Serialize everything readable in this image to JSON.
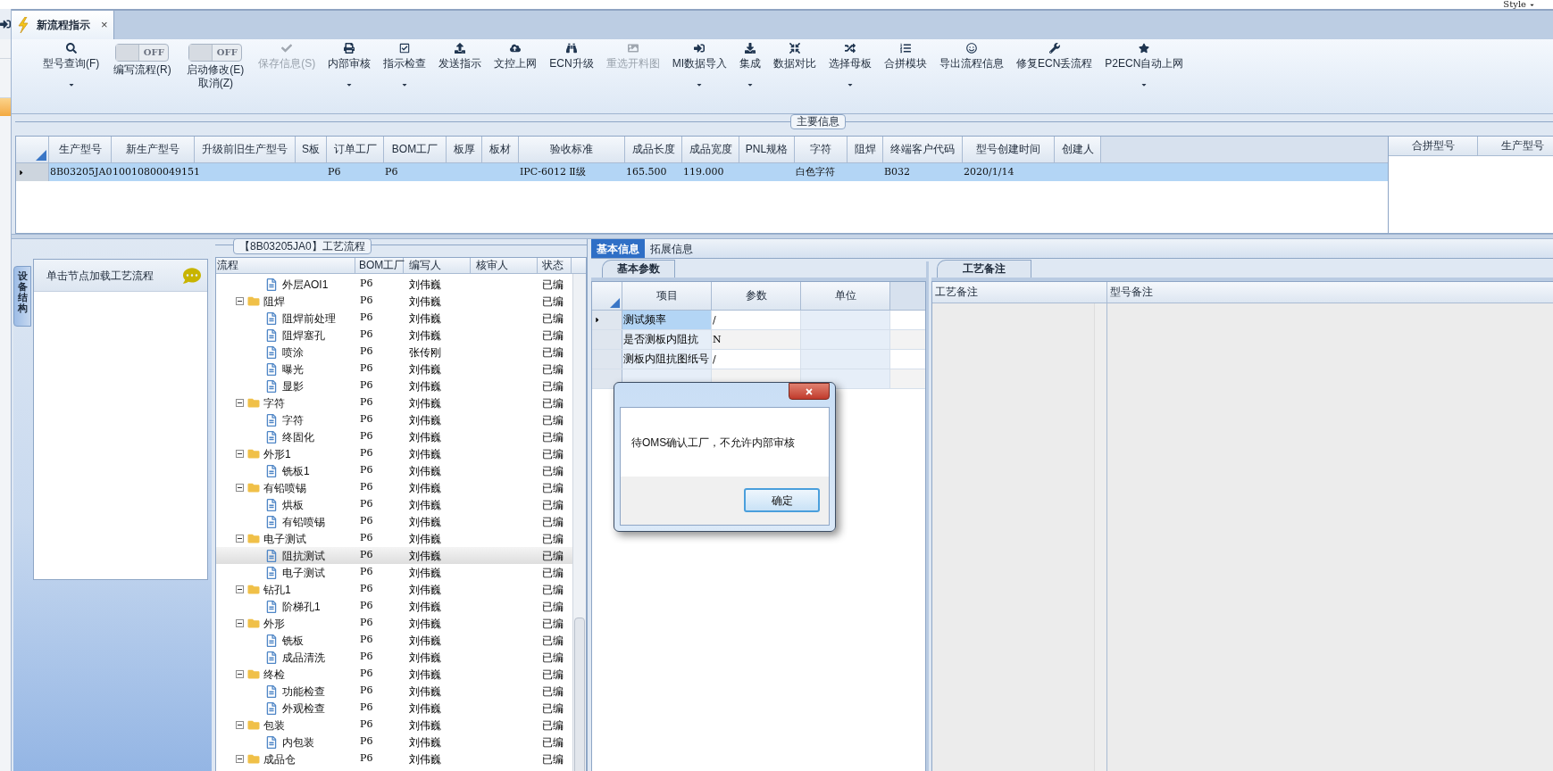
{
  "top_bar": {
    "style_menu": "Style"
  },
  "tabs": [
    {
      "label": "新流程指示",
      "selected": true,
      "close": "×"
    }
  ],
  "toolbar": [
    {
      "kind": "button",
      "label": "型号查询(F)",
      "disabled": false,
      "dropdown": true
    },
    {
      "kind": "toggle",
      "label": "编写流程(R)",
      "state_text": "OFF",
      "on": false
    },
    {
      "kind": "toggle",
      "label": "启动修改(E)\n取消(Z)",
      "state_text": "OFF",
      "on": false
    },
    {
      "kind": "button",
      "label": "保存信息(S)",
      "disabled": true,
      "dropdown": false
    },
    {
      "kind": "button",
      "label": "内部审核",
      "disabled": false,
      "dropdown": true
    },
    {
      "kind": "button",
      "label": "指示检查",
      "disabled": false,
      "dropdown": true
    },
    {
      "kind": "button",
      "label": "发送指示",
      "disabled": false,
      "dropdown": false
    },
    {
      "kind": "button",
      "label": "文控上网",
      "disabled": false,
      "dropdown": false
    },
    {
      "kind": "button",
      "label": "ECN升级",
      "disabled": false,
      "dropdown": false
    },
    {
      "kind": "button",
      "label": "重选开料图",
      "disabled": true,
      "dropdown": false
    },
    {
      "kind": "button",
      "label": "MI数据导入",
      "disabled": false,
      "dropdown": true
    },
    {
      "kind": "button",
      "label": "集成",
      "disabled": false,
      "dropdown": true
    },
    {
      "kind": "button",
      "label": "数据对比",
      "disabled": false,
      "dropdown": false
    },
    {
      "kind": "button",
      "label": "选择母板",
      "disabled": false,
      "dropdown": true
    },
    {
      "kind": "button",
      "label": "合拼模块",
      "disabled": false,
      "dropdown": false
    },
    {
      "kind": "button",
      "label": "导出流程信息",
      "disabled": false,
      "dropdown": false
    },
    {
      "kind": "button",
      "label": "修复ECN丢流程",
      "disabled": false,
      "dropdown": false
    },
    {
      "kind": "button",
      "label": "P2ECN自动上网",
      "disabled": false,
      "dropdown": true
    }
  ],
  "main_info": {
    "title": "主要信息",
    "columns": [
      "生产型号",
      "新生产型号",
      "升级前旧生产型号",
      "S板",
      "订单工厂",
      "BOM工厂",
      "板厚",
      "板材",
      "验收标准",
      "成品长度",
      "成品宽度",
      "PNL规格",
      "字符",
      "阻焊",
      "终端客户代码",
      "型号创建时间",
      "创建人"
    ],
    "rows": [
      {
        "selected": true,
        "cells": [
          "8B03205JA0",
          "10010800049151",
          null,
          null,
          "P6",
          "P6",
          null,
          null,
          "IPC-6012 Ⅱ级",
          "165.500",
          "119.000",
          null,
          "白色字符",
          null,
          "B032",
          "2020/1/14",
          null
        ]
      }
    ],
    "side_columns": [
      "合拼型号",
      "生产型号"
    ]
  },
  "process_panel": {
    "side_tab": "设备结构",
    "hint": "单击节点加载工艺流程",
    "title": "【8B03205JA0】工艺流程",
    "columns": [
      "流程",
      "BOM工厂",
      "编写人",
      "核审人",
      "状态"
    ],
    "rows": [
      {
        "children": [
          {
            "name": "外层AOI1",
            "bom": "P6",
            "writer": "刘伟巍",
            "status": "已编",
            "selected": false
          }
        ]
      },
      {
        "name": "阻焊",
        "bom": "P6",
        "writer": "刘伟巍",
        "status": "已编",
        "selected": false,
        "expanded": true,
        "children": [
          {
            "name": "阻焊前处理",
            "bom": "P6",
            "writer": "刘伟巍",
            "status": "已编",
            "selected": false
          },
          {
            "name": "阻焊塞孔",
            "bom": "P6",
            "writer": "刘伟巍",
            "status": "已编",
            "selected": false
          },
          {
            "name": "喷涂",
            "bom": "P6",
            "writer": "张传刚",
            "status": "已编",
            "selected": false
          },
          {
            "name": "曝光",
            "bom": "P6",
            "writer": "刘伟巍",
            "status": "已编",
            "selected": false
          },
          {
            "name": "显影",
            "bom": "P6",
            "writer": "刘伟巍",
            "status": "已编",
            "selected": false
          }
        ]
      },
      {
        "name": "字符",
        "bom": "P6",
        "writer": "刘伟巍",
        "status": "已编",
        "selected": false,
        "expanded": true,
        "children": [
          {
            "name": "字符",
            "bom": "P6",
            "writer": "刘伟巍",
            "status": "已编",
            "selected": false
          },
          {
            "name": "终固化",
            "bom": "P6",
            "writer": "刘伟巍",
            "status": "已编",
            "selected": false
          }
        ]
      },
      {
        "name": "外形1",
        "bom": "P6",
        "writer": "刘伟巍",
        "status": "已编",
        "selected": false,
        "expanded": true,
        "children": [
          {
            "name": "铣板1",
            "bom": "P6",
            "writer": "刘伟巍",
            "status": "已编",
            "selected": false
          }
        ]
      },
      {
        "name": "有铅喷锡",
        "bom": "P6",
        "writer": "刘伟巍",
        "status": "已编",
        "selected": false,
        "expanded": true,
        "children": [
          {
            "name": "烘板",
            "bom": "P6",
            "writer": "刘伟巍",
            "status": "已编",
            "selected": false
          },
          {
            "name": "有铅喷锡",
            "bom": "P6",
            "writer": "刘伟巍",
            "status": "已编",
            "selected": false
          }
        ]
      },
      {
        "name": "电子测试",
        "bom": "P6",
        "writer": "刘伟巍",
        "status": "已编",
        "selected": false,
        "expanded": true,
        "children": [
          {
            "name": "阻抗测试",
            "bom": "P6",
            "writer": "刘伟巍",
            "status": "已编",
            "selected": true
          },
          {
            "name": "电子测试",
            "bom": "P6",
            "writer": "刘伟巍",
            "status": "已编",
            "selected": false
          }
        ]
      },
      {
        "name": "钻孔1",
        "bom": "P6",
        "writer": "刘伟巍",
        "status": "已编",
        "selected": false,
        "expanded": true,
        "children": [
          {
            "name": "阶梯孔1",
            "bom": "P6",
            "writer": "刘伟巍",
            "status": "已编",
            "selected": false
          }
        ]
      },
      {
        "name": "外形",
        "bom": "P6",
        "writer": "刘伟巍",
        "status": "已编",
        "selected": false,
        "expanded": true,
        "children": [
          {
            "name": "铣板",
            "bom": "P6",
            "writer": "刘伟巍",
            "status": "已编",
            "selected": false
          },
          {
            "name": "成品清洗",
            "bom": "P6",
            "writer": "刘伟巍",
            "status": "已编",
            "selected": false
          }
        ]
      },
      {
        "name": "终检",
        "bom": "P6",
        "writer": "刘伟巍",
        "status": "已编",
        "selected": false,
        "expanded": true,
        "children": [
          {
            "name": "功能检查",
            "bom": "P6",
            "writer": "刘伟巍",
            "status": "已编",
            "selected": false
          },
          {
            "name": "外观检查",
            "bom": "P6",
            "writer": "刘伟巍",
            "status": "已编",
            "selected": false
          }
        ]
      },
      {
        "name": "包装",
        "bom": "P6",
        "writer": "刘伟巍",
        "status": "已编",
        "selected": false,
        "expanded": true,
        "children": [
          {
            "name": "内包装",
            "bom": "P6",
            "writer": "刘伟巍",
            "status": "已编",
            "selected": false
          }
        ]
      },
      {
        "name": "成品仓",
        "bom": "P6",
        "writer": "刘伟巍",
        "status": "已编",
        "selected": false,
        "expanded": true
      }
    ]
  },
  "detail": {
    "tabs": [
      {
        "label": "基本信息",
        "selected": true
      },
      {
        "label": "拓展信息",
        "selected": false
      }
    ],
    "params": {
      "tab": "基本参数",
      "columns": [
        "项目",
        "参数",
        "单位"
      ],
      "rows": [
        {
          "item": "测试频率",
          "value": "/",
          "selected": true
        },
        {
          "item": "是否测板内阻抗",
          "value": "N",
          "selected": false
        },
        {
          "item": "测板内阻抗图纸号",
          "value": "/",
          "selected": false
        },
        {
          "selected": false
        }
      ]
    },
    "notes": {
      "tab": "工艺备注",
      "columns": [
        "工艺备注",
        "型号备注"
      ]
    }
  },
  "dialog": {
    "message": "待OMS确认工厂，不允许内部审核",
    "ok": "确定"
  }
}
